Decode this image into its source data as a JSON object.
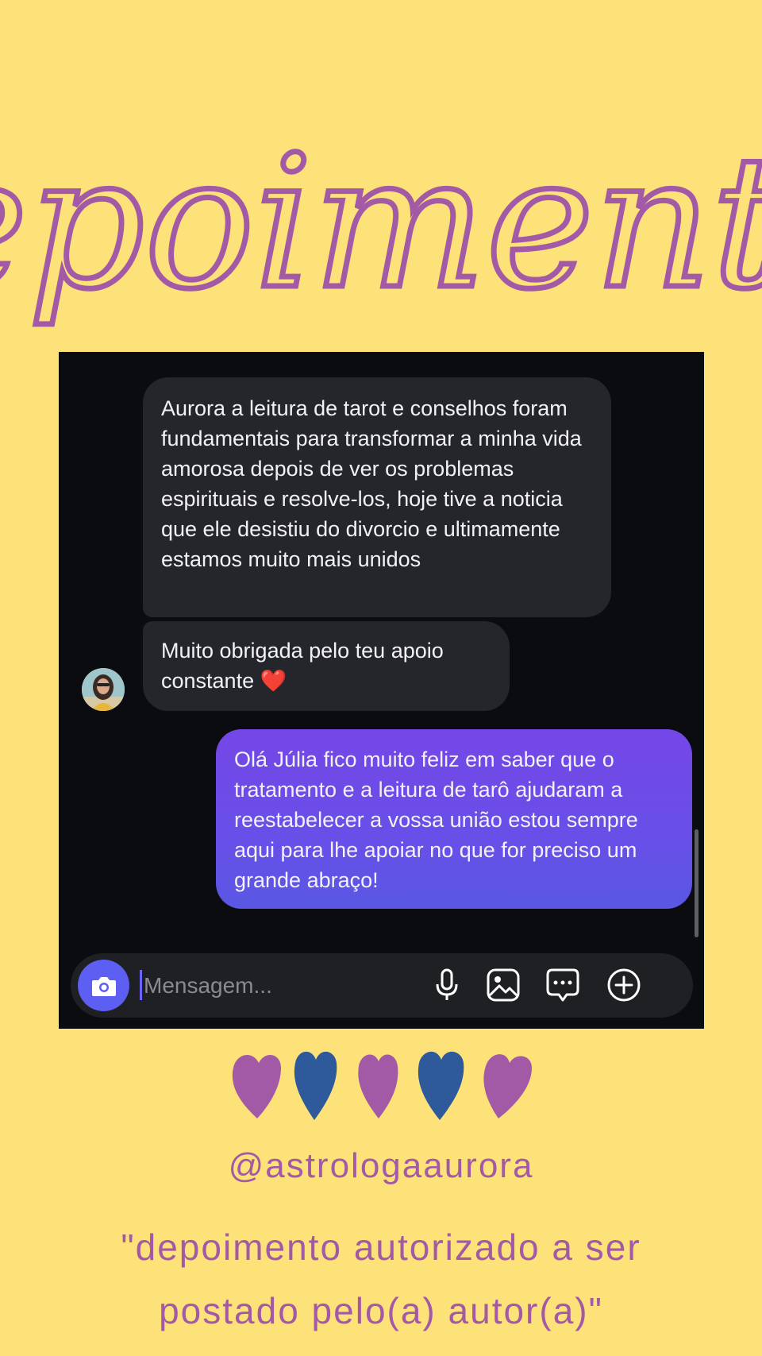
{
  "title": "Depoimentos",
  "chat": {
    "incoming": [
      "Aurora a leitura de tarot e conselhos foram fundamentais para transformar a minha vida amorosa depois de ver os problemas espirituais e resolve-los, hoje tive a noticia que ele desistiu do divorcio e ultimamente estamos muito mais unidos",
      "Muito obrigada pelo teu apoio constante ❤️"
    ],
    "outgoing": "Olá Júlia fico muito feliz em saber que o tratamento e a leitura de tarô ajudaram a reestabelecer a vossa união estou sempre aqui para lhe apoiar no que for preciso um grande abraço!",
    "composer": {
      "placeholder": "Mensagem...",
      "icons": [
        "camera-icon",
        "microphone-icon",
        "image-icon",
        "sticker-icon",
        "plus-circle-icon"
      ]
    }
  },
  "hearts": [
    "purple",
    "blue",
    "purple",
    "blue",
    "purple"
  ],
  "colors": {
    "background": "#fde27a",
    "purple": "#a35aa6",
    "blue": "#2e5a9c",
    "chat_bg": "#0b0c10",
    "outgoing": "#6a4ee8"
  },
  "handle": "@astrologaaurora",
  "note": "\"depoimento autorizado a ser postado pelo(a) autor(a)\""
}
